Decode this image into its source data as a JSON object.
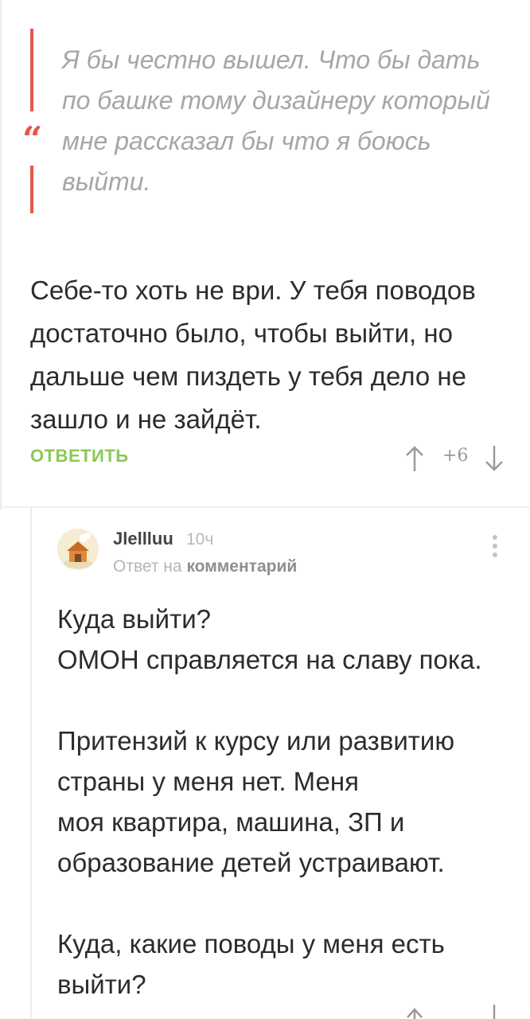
{
  "quote": {
    "text": "Я бы честно вышел. Что бы дать по башке тому дизайнеру который мне рассказал бы что я боюсь выйти."
  },
  "comment": {
    "body": "Себе-то хоть не ври. У тебя поводов достаточно было, чтобы выйти, но дальше чем пиздеть у тебя дело не зашло и не зайдёт.",
    "reply_label": "ОТВЕТИТЬ",
    "rating": "+6"
  },
  "reply": {
    "username": "Jlellluu",
    "time": "10ч",
    "reply_to_prefix": "Ответ на",
    "reply_to_link": "комментарий",
    "body": "Куда выйти?\nОМОН справляется на славу пока.\n\nПритензий к курсу или развитию страны у меня нет. Меня\nмоя квартира, машина, ЗП и образование детей устраивают.\n\nКуда, какие поводы у меня есть выйти?"
  },
  "icons": {
    "quote": "quote-mark-icon",
    "upvote": "arrow-up-icon",
    "downvote": "arrow-down-icon",
    "menu": "more-vertical-icon",
    "avatar": "avatar-icon"
  },
  "colors": {
    "accent_red": "#e4574a",
    "reply_green": "#8ac858",
    "text": "#2c2c2c",
    "muted": "#a6a6a6"
  }
}
